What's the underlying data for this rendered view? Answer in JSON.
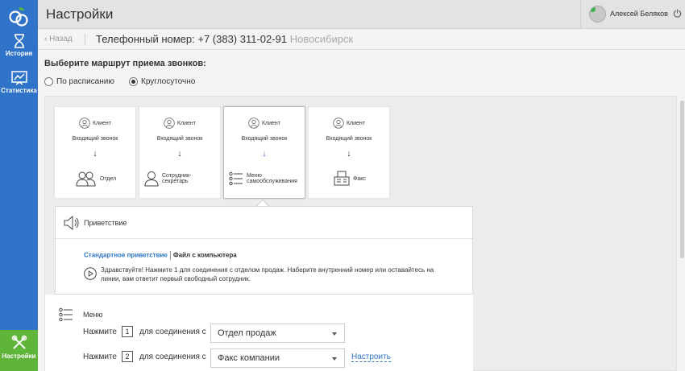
{
  "sidebar": {
    "items": [
      {
        "label": "История",
        "icon": "hourglass-icon"
      },
      {
        "label": "Статистика",
        "icon": "chart-icon"
      },
      {
        "label": "Настройки",
        "icon": "tools-icon"
      }
    ]
  },
  "header": {
    "title": "Настройки",
    "user_name": "Алексей Беляков"
  },
  "subbar": {
    "back_label": "Назад",
    "phone_prefix": "Телефонный номер: +7 (383) 311-02-91",
    "city": "Новосибирск"
  },
  "routing": {
    "title": "Выберите маршрут приема звонков:",
    "options": [
      "По расписанию",
      "Круглосуточно"
    ],
    "selected": "Круглосуточно"
  },
  "cards": [
    {
      "client": "Клиент",
      "incoming": "Входящий звонок",
      "arrow": "↓",
      "dest": "Отдел",
      "icon": "group-icon"
    },
    {
      "client": "Клиент",
      "incoming": "Входящий звонок",
      "arrow": "↓",
      "dest": "Сотрудник-секретарь",
      "icon": "person-icon"
    },
    {
      "client": "Клиент",
      "incoming": "Входящий звонок",
      "arrow": "↓",
      "dest": "Меню самообслуживания",
      "icon": "list-icon"
    },
    {
      "client": "Клиент",
      "incoming": "Входящий звонок",
      "arrow": "↓",
      "dest": "Факс",
      "icon": "fax-icon"
    }
  ],
  "greeting": {
    "title": "Приветствие",
    "tab_standard": "Стандартное приветствие",
    "tab_file": "Файл с компьютера",
    "text": "Здравствуйте! Нажмите 1 для соединения с отделом продаж. Наберите внутренний номер или оставайтесь на линии, вам ответит первый свободный сотрудник."
  },
  "menu": {
    "title": "Меню",
    "rows": [
      {
        "press": "Нажмите",
        "key": "1",
        "connect": "для соединения с",
        "value": "Отдел продаж"
      },
      {
        "press": "Нажмите",
        "key": "2",
        "connect": "для соединения с",
        "value": "Факс компании",
        "configure": "Настроить"
      }
    ]
  },
  "colors": {
    "sidebar": "#2f74c9",
    "active_nav": "#5fb53a",
    "link": "#2f74c9"
  }
}
